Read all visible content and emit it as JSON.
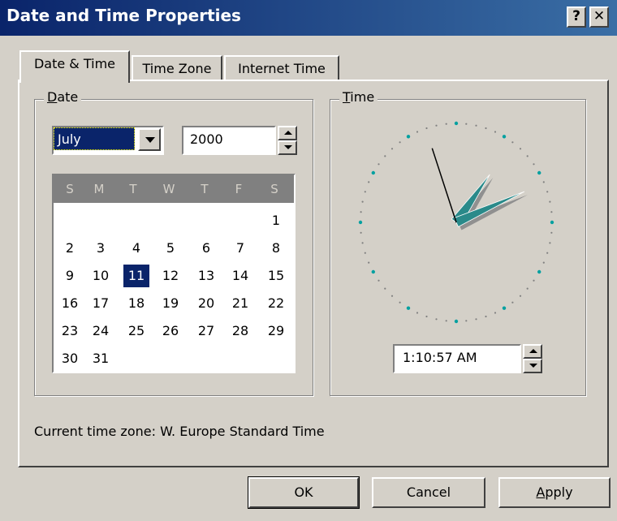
{
  "window": {
    "title": "Date and Time Properties",
    "help_button": "?",
    "close_button": "✕"
  },
  "tabs": [
    {
      "label": "Date & Time"
    },
    {
      "label": "Time Zone"
    },
    {
      "label": "Internet Time"
    }
  ],
  "date_group": {
    "legend_first": "D",
    "legend_rest": "ate",
    "month": "July",
    "year": "2000",
    "weekday_headers": [
      "S",
      "M",
      "T",
      "W",
      "T",
      "F",
      "S"
    ],
    "days": [
      "1",
      "2",
      "3",
      "4",
      "5",
      "6",
      "7",
      "8",
      "9",
      "10",
      "11",
      "12",
      "13",
      "14",
      "15",
      "16",
      "17",
      "18",
      "19",
      "20",
      "21",
      "22",
      "23",
      "24",
      "25",
      "26",
      "27",
      "28",
      "29",
      "30",
      "31"
    ],
    "selected_day": "11"
  },
  "time_group": {
    "legend_first": "T",
    "legend_rest": "ime",
    "time_value": "1:10:57 AM",
    "clock": {
      "hours": 1,
      "minutes": 10,
      "seconds": 57,
      "hand_color": "#2a8a8a"
    }
  },
  "timezone": {
    "text": "Current time zone:  W. Europe Standard Time"
  },
  "buttons": {
    "ok": "OK",
    "cancel": "Cancel",
    "apply_first": "A",
    "apply_rest": "pply"
  },
  "colors": {
    "titlebar": "#0a246a",
    "face": "#d4d0c8",
    "selection": "#0a246a",
    "clock_dot": "#00a0a0"
  }
}
